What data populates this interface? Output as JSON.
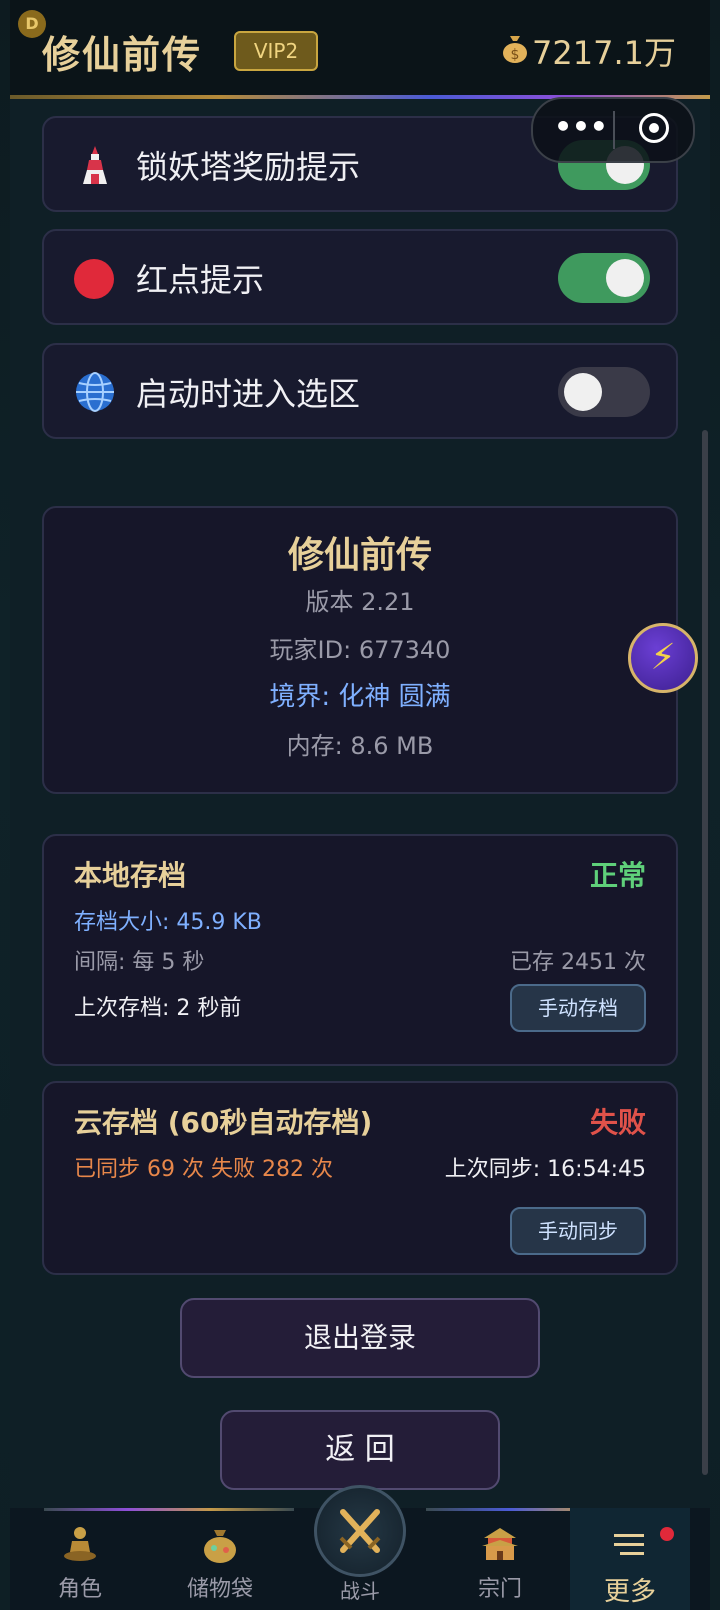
{
  "header": {
    "badge": "D",
    "title": "修仙前传",
    "vip": "VIP2",
    "coins": "7217.1万"
  },
  "capsule": {
    "more": "•••"
  },
  "settings": [
    {
      "label": "锁妖塔奖励提示",
      "icon": "tower-icon",
      "enabled": true
    },
    {
      "label": "红点提示",
      "icon": "red-dot-icon",
      "enabled": true
    },
    {
      "label": "启动时进入选区",
      "icon": "globe-icon",
      "enabled": false
    }
  ],
  "info": {
    "name": "修仙前传",
    "version": "版本 2.21",
    "player_id": "玩家ID: 677340",
    "realm": "境界: 化神 圆满",
    "memory": "内存: 8.6 MB"
  },
  "quick_button": "⚡",
  "local_save": {
    "title": "本地存档",
    "status": "正常",
    "size": "存档大小: 45.9 KB",
    "interval": "间隔: 每 5 秒",
    "count": "已存 2451 次",
    "last": "上次存档: 2 秒前",
    "button": "手动存档"
  },
  "cloud_save": {
    "title": "云存档 (60秒自动存档)",
    "status": "失败",
    "stats": "已同步 69 次  失败 282 次",
    "last_sync": "上次同步: 16:54:45",
    "button": "手动同步"
  },
  "logout": "退出登录",
  "back": "返 回",
  "tabs": [
    {
      "label": "角色",
      "icon": "meditating-figure-icon"
    },
    {
      "label": "储物袋",
      "icon": "storage-bag-icon"
    },
    {
      "label": "战斗",
      "icon": "crossed-swords-icon"
    },
    {
      "label": "宗门",
      "icon": "temple-icon"
    },
    {
      "label": "更多",
      "icon": "menu-icon",
      "active": true
    }
  ],
  "colors": {
    "gold": "#e7d09a",
    "toggle_on": "#3f9a5e",
    "ok_green": "#5fd07a",
    "fail_red": "#e0524a",
    "info_blue": "#7fb0ff"
  }
}
